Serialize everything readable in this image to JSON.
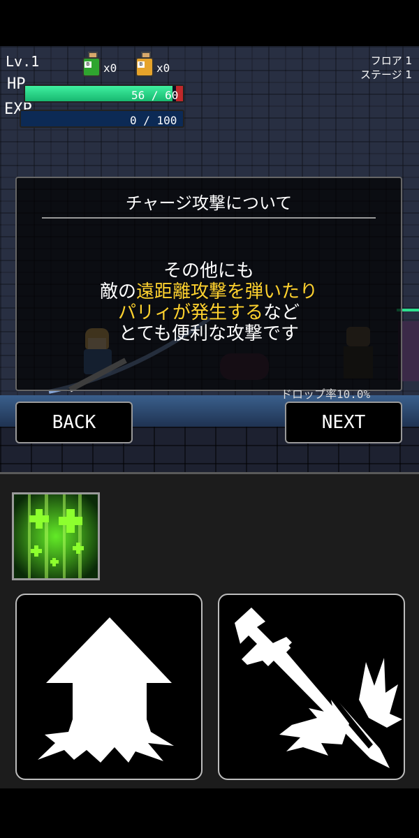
{
  "hud": {
    "level": "Lv.1",
    "hp_label": "HP",
    "exp_label": "EXP",
    "hp_text": "56 / 60",
    "hp_value": 56,
    "hp_max": 60,
    "exp_text": "0 / 100",
    "exp_value": 0,
    "exp_max": 100,
    "green_potion_count": "x0",
    "orange_potion_count": "x0",
    "floor": "フロア 1",
    "stage": "ステージ 1"
  },
  "dialog": {
    "title": "チャージ攻撃について",
    "line1": "その他にも",
    "line2_a": "敵の",
    "line2_b": "遠距離攻撃を弾いたり",
    "line3_a": "パリィが発生する",
    "line3_b": "など",
    "line4": "とても便利な攻撃です"
  },
  "drop_rate": "ドロップ率10.0%",
  "buttons": {
    "back": "BACK",
    "next": "NEXT"
  },
  "icons": {
    "skill": "heal-skill-icon",
    "jump": "jump-arrow-icon",
    "attack": "sword-charge-icon"
  },
  "colors": {
    "hp": "#2ee08f",
    "exp": "#0c2a55",
    "highlight": "#ffd22e",
    "skill_green": "#6cff2a"
  }
}
